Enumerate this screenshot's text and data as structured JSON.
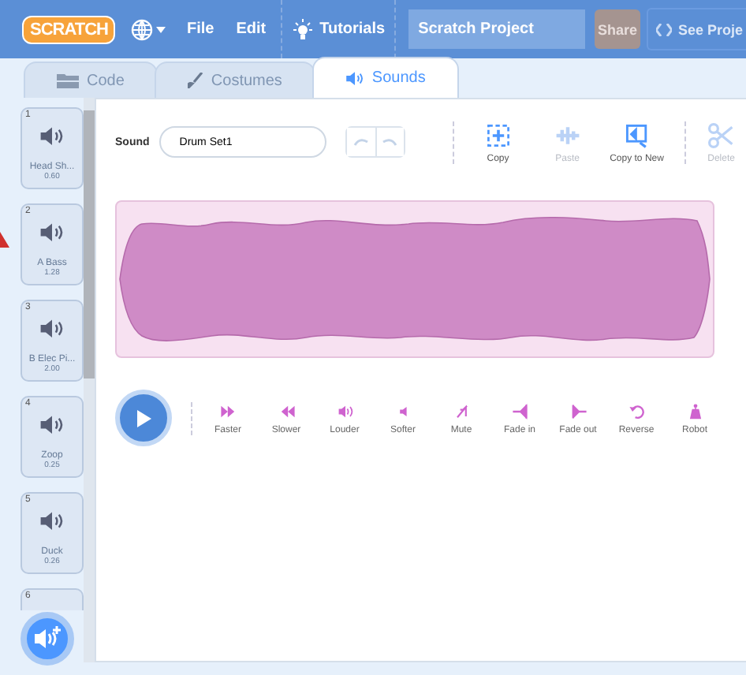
{
  "menu_bar": {
    "logo": "SCRATCH",
    "items": [
      {
        "label": "File"
      },
      {
        "label": "Edit"
      }
    ],
    "tutorials": "Tutorials",
    "project_title": "Scratch Project",
    "share": "Share",
    "see_project": "See Proje"
  },
  "tabs": [
    {
      "label": "Code",
      "selected": false
    },
    {
      "label": "Costumes",
      "selected": false
    },
    {
      "label": "Sounds",
      "selected": true
    }
  ],
  "sounds": [
    {
      "number": "1",
      "name": "Head Sh...",
      "duration": "0.60"
    },
    {
      "number": "2",
      "name": "A Bass",
      "duration": "1.28"
    },
    {
      "number": "3",
      "name": "B Elec Pi...",
      "duration": "2.00"
    },
    {
      "number": "4",
      "name": "Zoop",
      "duration": "0.25"
    },
    {
      "number": "5",
      "name": "Duck",
      "duration": "0.26"
    },
    {
      "number": "6"
    }
  ],
  "editor": {
    "sound_label": "Sound",
    "sound_name": "Drum Set1",
    "tools": [
      {
        "label": "Copy",
        "disabled": false
      },
      {
        "label": "Paste",
        "disabled": true
      },
      {
        "label": "Copy to New",
        "disabled": false
      },
      {
        "label": "Delete",
        "disabled": true
      }
    ],
    "effects": [
      {
        "label": "Faster"
      },
      {
        "label": "Slower"
      },
      {
        "label": "Louder"
      },
      {
        "label": "Softer"
      },
      {
        "label": "Mute"
      },
      {
        "label": "Fade in"
      },
      {
        "label": "Fade out"
      },
      {
        "label": "Reverse"
      },
      {
        "label": "Robot"
      }
    ]
  }
}
